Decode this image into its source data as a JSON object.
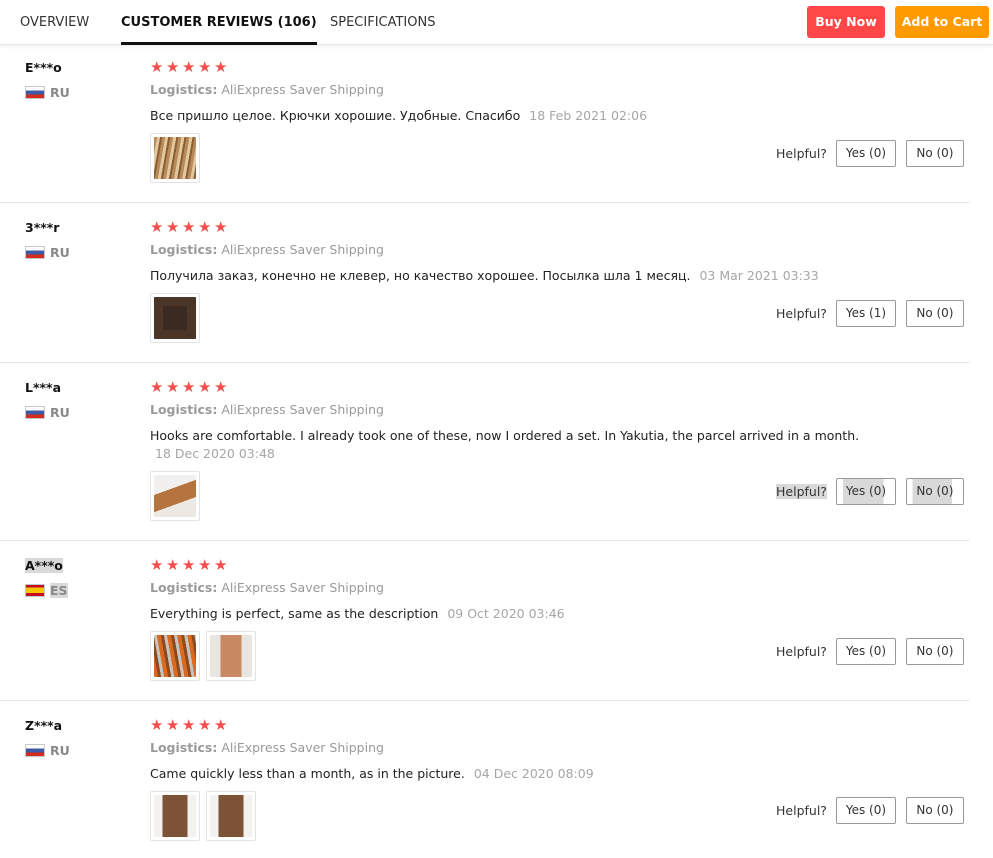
{
  "tabs": {
    "overview": "OVERVIEW",
    "reviews": "CUSTOMER REVIEWS (106)",
    "specifications": "SPECIFICATIONS"
  },
  "actions": {
    "buy_now": "Buy Now",
    "add_to_cart": "Add to Cart"
  },
  "colors": {
    "buy_now": "#ff4747",
    "add_to_cart": "#ff9a00",
    "stars": "#f24e4e"
  },
  "review_common": {
    "logistics_label": "Logistics:",
    "helpful_label": "Helpful?"
  },
  "reviews": [
    {
      "user": "E***o",
      "country": "RU",
      "flag_icon": "russia-flag-icon",
      "rating": 5,
      "logistics": "AliExpress Saver Shipping",
      "text": "Все пришло целое. Крючки хорошие. Удобные. Спасибо",
      "date": "18 Feb 2021 02:06",
      "photos": 1,
      "yes": "Yes (0)",
      "no": "No (0)"
    },
    {
      "user": "3***r",
      "country": "RU",
      "flag_icon": "russia-flag-icon",
      "rating": 5,
      "logistics": "AliExpress Saver Shipping",
      "text": "Получила заказ, конечно не клевер, но качество хорошее. Посылка шла 1 месяц.",
      "date": "03 Mar 2021 03:33",
      "photos": 1,
      "yes": "Yes (1)",
      "no": "No (0)"
    },
    {
      "user": "L***a",
      "country": "RU",
      "flag_icon": "russia-flag-icon",
      "rating": 5,
      "logistics": "AliExpress Saver Shipping",
      "text": "Hooks are comfortable. I already took one of these, now I ordered a set. In Yakutia, the parcel arrived in a month.",
      "date": "18 Dec 2020 03:48",
      "photos": 1,
      "yes": "Yes (0)",
      "no": "No (0)"
    },
    {
      "user": "A***o",
      "country": "ES",
      "flag_icon": "spain-flag-icon",
      "rating": 5,
      "logistics": "AliExpress Saver Shipping",
      "text": "Everything is perfect, same as the description",
      "date": "09 Oct 2020 03:46",
      "photos": 2,
      "yes": "Yes (0)",
      "no": "No (0)"
    },
    {
      "user": "Z***a",
      "country": "RU",
      "flag_icon": "russia-flag-icon",
      "rating": 5,
      "logistics": "AliExpress Saver Shipping",
      "text": "Came quickly less than a month, as in the picture.",
      "date": "04 Dec 2020 08:09",
      "photos": 2,
      "yes": "Yes (0)",
      "no": "No (0)"
    }
  ]
}
